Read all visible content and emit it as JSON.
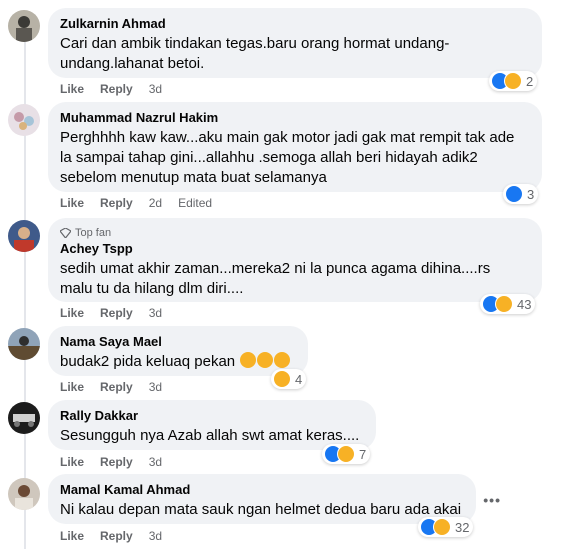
{
  "comments": [
    {
      "author": "Zulkarnin Ahmad",
      "line1": "Cari dan ambik tindakan tegas.baru orang hormat undang-",
      "line2": "undang.lahanat betoi.",
      "like": "Like",
      "reply": "Reply",
      "time": "3d",
      "reactions": "2"
    },
    {
      "author": "Muhammad Nazrul Hakim",
      "line1": "Perghhhh kaw kaw...aku main gak motor jadi gak mat rempit tak ade",
      "line2": "la sampai tahap gini...allahhu .semoga allah beri hidayah adik2",
      "line3": "sebelom menutup mata buat selamanya",
      "like": "Like",
      "reply": "Reply",
      "time": "2d",
      "edited": "Edited",
      "reactions": "3"
    },
    {
      "badge": "Top fan",
      "author": "Achey Tspp",
      "line1": "sedih umat akhir zaman...mereka2 ni la punca agama dihina....rs",
      "line2": "malu tu da hilang dlm diri....",
      "like": "Like",
      "reply": "Reply",
      "time": "3d",
      "reactions": "43"
    },
    {
      "author": "Nama Saya Mael",
      "line1": "budak2 pida keluaq pekan",
      "like": "Like",
      "reply": "Reply",
      "time": "3d",
      "reactions": "4"
    },
    {
      "author": "Rally Dakkar",
      "line1": "Sesungguh nya Azab allah swt amat keras....",
      "like": "Like",
      "reply": "Reply",
      "time": "3d",
      "reactions": "7"
    },
    {
      "author": "Mamal Kamal Ahmad",
      "line1": "Ni kalau depan mata sauk ngan helmet dedua baru ada akai",
      "like": "Like",
      "reply": "Reply",
      "time": "3d",
      "reactions": "32",
      "more": "•••"
    }
  ]
}
